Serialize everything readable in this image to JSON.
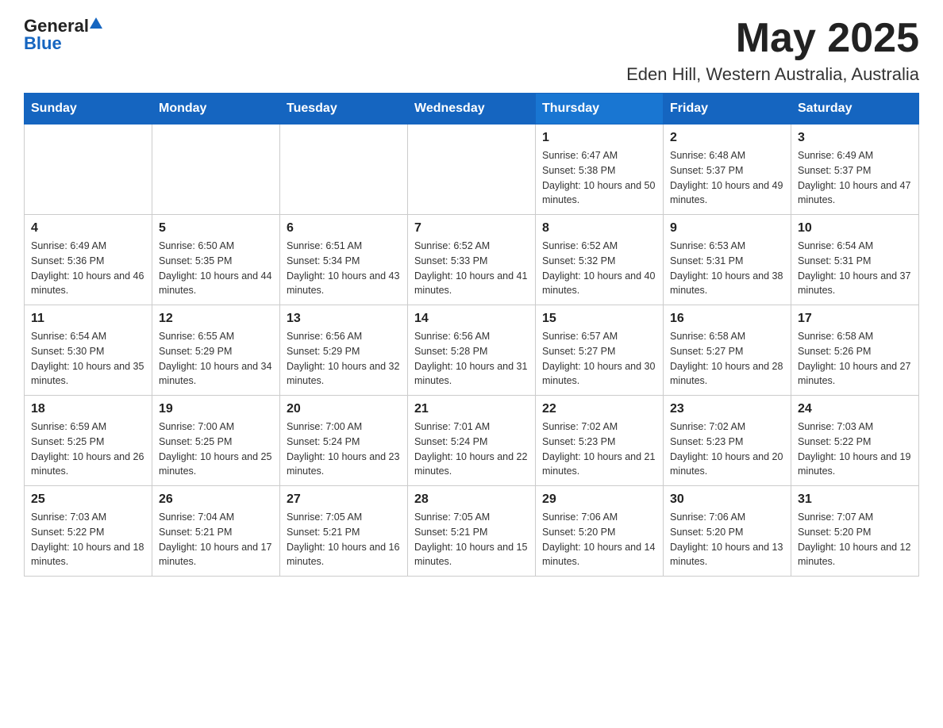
{
  "header": {
    "logo_general": "General",
    "logo_blue": "Blue",
    "month_title": "May 2025",
    "location": "Eden Hill, Western Australia, Australia"
  },
  "days_of_week": [
    "Sunday",
    "Monday",
    "Tuesday",
    "Wednesday",
    "Thursday",
    "Friday",
    "Saturday"
  ],
  "weeks": [
    [
      {
        "day": "",
        "info": ""
      },
      {
        "day": "",
        "info": ""
      },
      {
        "day": "",
        "info": ""
      },
      {
        "day": "",
        "info": ""
      },
      {
        "day": "1",
        "info": "Sunrise: 6:47 AM\nSunset: 5:38 PM\nDaylight: 10 hours and 50 minutes."
      },
      {
        "day": "2",
        "info": "Sunrise: 6:48 AM\nSunset: 5:37 PM\nDaylight: 10 hours and 49 minutes."
      },
      {
        "day": "3",
        "info": "Sunrise: 6:49 AM\nSunset: 5:37 PM\nDaylight: 10 hours and 47 minutes."
      }
    ],
    [
      {
        "day": "4",
        "info": "Sunrise: 6:49 AM\nSunset: 5:36 PM\nDaylight: 10 hours and 46 minutes."
      },
      {
        "day": "5",
        "info": "Sunrise: 6:50 AM\nSunset: 5:35 PM\nDaylight: 10 hours and 44 minutes."
      },
      {
        "day": "6",
        "info": "Sunrise: 6:51 AM\nSunset: 5:34 PM\nDaylight: 10 hours and 43 minutes."
      },
      {
        "day": "7",
        "info": "Sunrise: 6:52 AM\nSunset: 5:33 PM\nDaylight: 10 hours and 41 minutes."
      },
      {
        "day": "8",
        "info": "Sunrise: 6:52 AM\nSunset: 5:32 PM\nDaylight: 10 hours and 40 minutes."
      },
      {
        "day": "9",
        "info": "Sunrise: 6:53 AM\nSunset: 5:31 PM\nDaylight: 10 hours and 38 minutes."
      },
      {
        "day": "10",
        "info": "Sunrise: 6:54 AM\nSunset: 5:31 PM\nDaylight: 10 hours and 37 minutes."
      }
    ],
    [
      {
        "day": "11",
        "info": "Sunrise: 6:54 AM\nSunset: 5:30 PM\nDaylight: 10 hours and 35 minutes."
      },
      {
        "day": "12",
        "info": "Sunrise: 6:55 AM\nSunset: 5:29 PM\nDaylight: 10 hours and 34 minutes."
      },
      {
        "day": "13",
        "info": "Sunrise: 6:56 AM\nSunset: 5:29 PM\nDaylight: 10 hours and 32 minutes."
      },
      {
        "day": "14",
        "info": "Sunrise: 6:56 AM\nSunset: 5:28 PM\nDaylight: 10 hours and 31 minutes."
      },
      {
        "day": "15",
        "info": "Sunrise: 6:57 AM\nSunset: 5:27 PM\nDaylight: 10 hours and 30 minutes."
      },
      {
        "day": "16",
        "info": "Sunrise: 6:58 AM\nSunset: 5:27 PM\nDaylight: 10 hours and 28 minutes."
      },
      {
        "day": "17",
        "info": "Sunrise: 6:58 AM\nSunset: 5:26 PM\nDaylight: 10 hours and 27 minutes."
      }
    ],
    [
      {
        "day": "18",
        "info": "Sunrise: 6:59 AM\nSunset: 5:25 PM\nDaylight: 10 hours and 26 minutes."
      },
      {
        "day": "19",
        "info": "Sunrise: 7:00 AM\nSunset: 5:25 PM\nDaylight: 10 hours and 25 minutes."
      },
      {
        "day": "20",
        "info": "Sunrise: 7:00 AM\nSunset: 5:24 PM\nDaylight: 10 hours and 23 minutes."
      },
      {
        "day": "21",
        "info": "Sunrise: 7:01 AM\nSunset: 5:24 PM\nDaylight: 10 hours and 22 minutes."
      },
      {
        "day": "22",
        "info": "Sunrise: 7:02 AM\nSunset: 5:23 PM\nDaylight: 10 hours and 21 minutes."
      },
      {
        "day": "23",
        "info": "Sunrise: 7:02 AM\nSunset: 5:23 PM\nDaylight: 10 hours and 20 minutes."
      },
      {
        "day": "24",
        "info": "Sunrise: 7:03 AM\nSunset: 5:22 PM\nDaylight: 10 hours and 19 minutes."
      }
    ],
    [
      {
        "day": "25",
        "info": "Sunrise: 7:03 AM\nSunset: 5:22 PM\nDaylight: 10 hours and 18 minutes."
      },
      {
        "day": "26",
        "info": "Sunrise: 7:04 AM\nSunset: 5:21 PM\nDaylight: 10 hours and 17 minutes."
      },
      {
        "day": "27",
        "info": "Sunrise: 7:05 AM\nSunset: 5:21 PM\nDaylight: 10 hours and 16 minutes."
      },
      {
        "day": "28",
        "info": "Sunrise: 7:05 AM\nSunset: 5:21 PM\nDaylight: 10 hours and 15 minutes."
      },
      {
        "day": "29",
        "info": "Sunrise: 7:06 AM\nSunset: 5:20 PM\nDaylight: 10 hours and 14 minutes."
      },
      {
        "day": "30",
        "info": "Sunrise: 7:06 AM\nSunset: 5:20 PM\nDaylight: 10 hours and 13 minutes."
      },
      {
        "day": "31",
        "info": "Sunrise: 7:07 AM\nSunset: 5:20 PM\nDaylight: 10 hours and 12 minutes."
      }
    ]
  ]
}
